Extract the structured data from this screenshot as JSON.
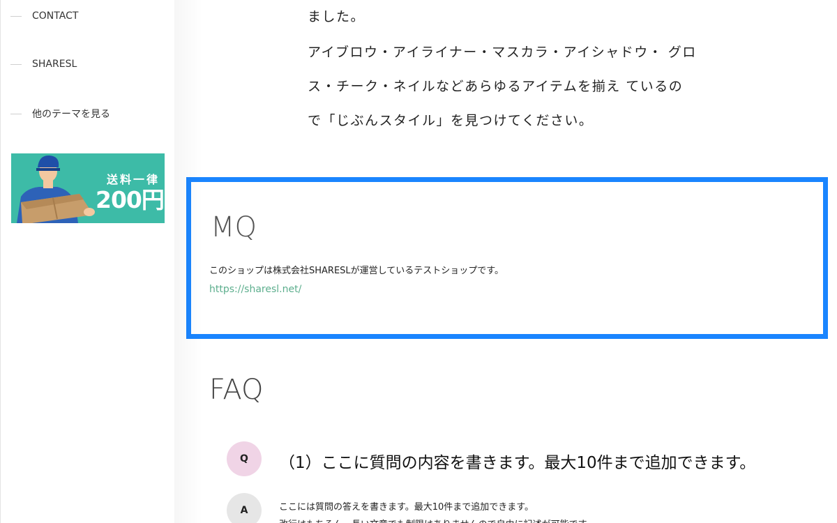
{
  "sidebar": {
    "items": [
      {
        "label": "CONTACT"
      },
      {
        "label": "SHARESL"
      },
      {
        "label": "他のテーマを見る"
      }
    ],
    "banner": {
      "line1": "送料一律",
      "line2": "200円"
    }
  },
  "main": {
    "intro": [
      "ました。",
      "アイブロウ・アイライナー・マスカラ・アイシャドウ・ グロ",
      "ス・チーク・ネイルなどあらゆるアイテムを揃え ているの",
      "で「じぶんスタイル」を見つけてください。"
    ],
    "mq": {
      "title": "MQ",
      "text": "このショップは株式会社SHARESLが運営しているテストショップです。",
      "link": "https://sharesl.net/"
    },
    "faq": {
      "title": "FAQ",
      "q_badge": "Q",
      "a_badge": "A",
      "question": "（1）ここに質問の内容を書きます。最大10件まで追加できます。",
      "answer_1": "ここには質問の答えを書きます。最大10件まで追加できます。",
      "answer_2": "改行はもちろん、長い文章でも制限はありませんので自由に記述が可能です。"
    }
  },
  "colors": {
    "highlight_border": "#1a85ff",
    "banner_bg": "#3dbba7",
    "link": "#5cae8d",
    "q_badge": "#f0d4e6",
    "a_badge": "#e6e6e6"
  }
}
